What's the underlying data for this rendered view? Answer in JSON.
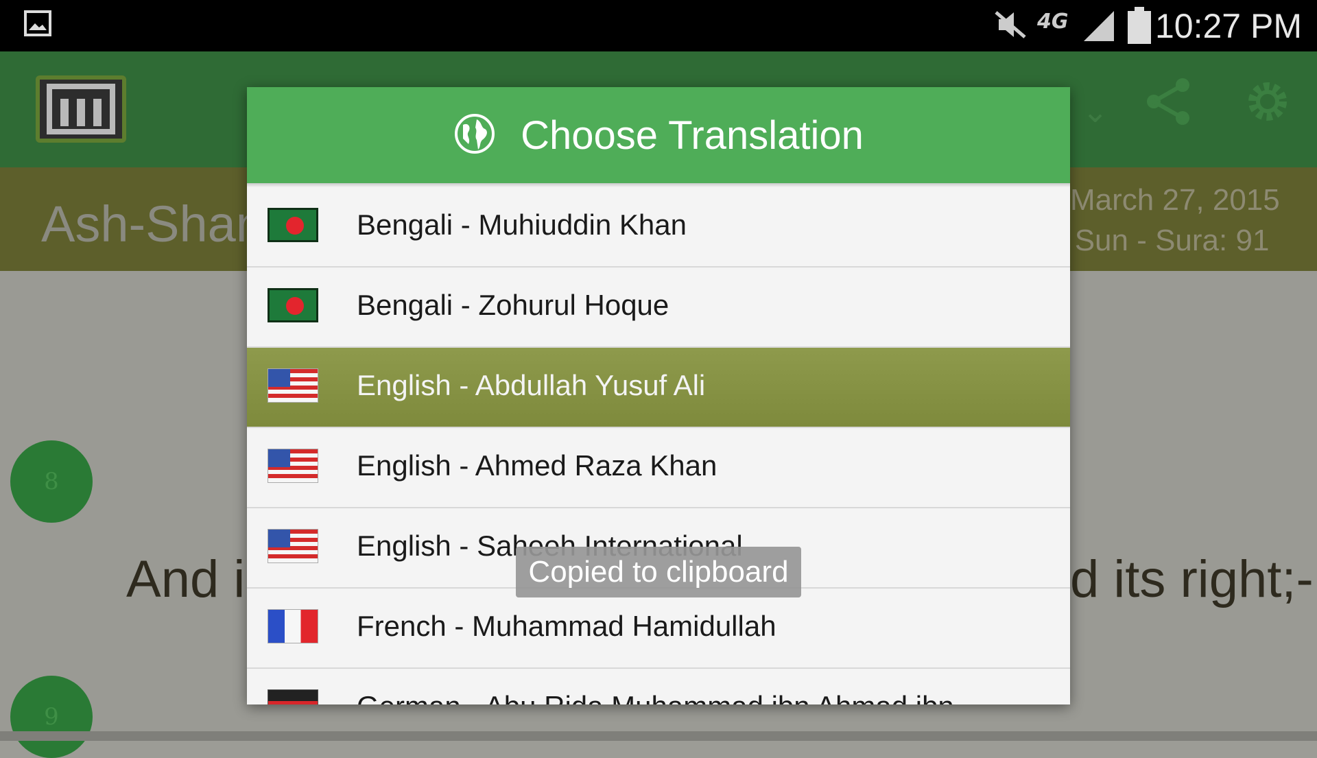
{
  "status_bar": {
    "time": "10:27 PM",
    "icons": [
      "image-icon",
      "mute-icon",
      "4g-lte-icon",
      "signal-icon",
      "battery-icon"
    ]
  },
  "background_app": {
    "surah_title": "Ash-Shan",
    "date": "March 27, 2015",
    "sura_info": "e Sun - Sura: 91",
    "language_selector": "i",
    "verse_left": "And i",
    "verse_right": "d its right;-",
    "verse_numbers": [
      "8",
      "9"
    ]
  },
  "dialog": {
    "title": "Choose Translation",
    "items": [
      {
        "label": "Bengali - Muhiuddin Khan",
        "flag": "bangladesh-flag-icon",
        "selected": false
      },
      {
        "label": "Bengali - Zohurul Hoque",
        "flag": "bangladesh-flag-icon",
        "selected": false
      },
      {
        "label": "English - Abdullah Yusuf Ali",
        "flag": "usa-flag-icon",
        "selected": true
      },
      {
        "label": "English - Ahmed Raza Khan",
        "flag": "usa-flag-icon",
        "selected": false
      },
      {
        "label": "English - Saheeh International",
        "flag": "usa-flag-icon",
        "selected": false
      },
      {
        "label": "French - Muhammad Hamidullah",
        "flag": "france-flag-icon",
        "selected": false
      },
      {
        "label": "German - Abu Rida Muhammad ibn Ahmad ibn",
        "flag": "germany-flag-icon",
        "selected": false
      }
    ]
  },
  "toast": {
    "message": "Copied to clipboard"
  },
  "colors": {
    "header_green": "#4fad58",
    "selected_olive": "#8e9a4c",
    "status_bar": "#000000"
  }
}
